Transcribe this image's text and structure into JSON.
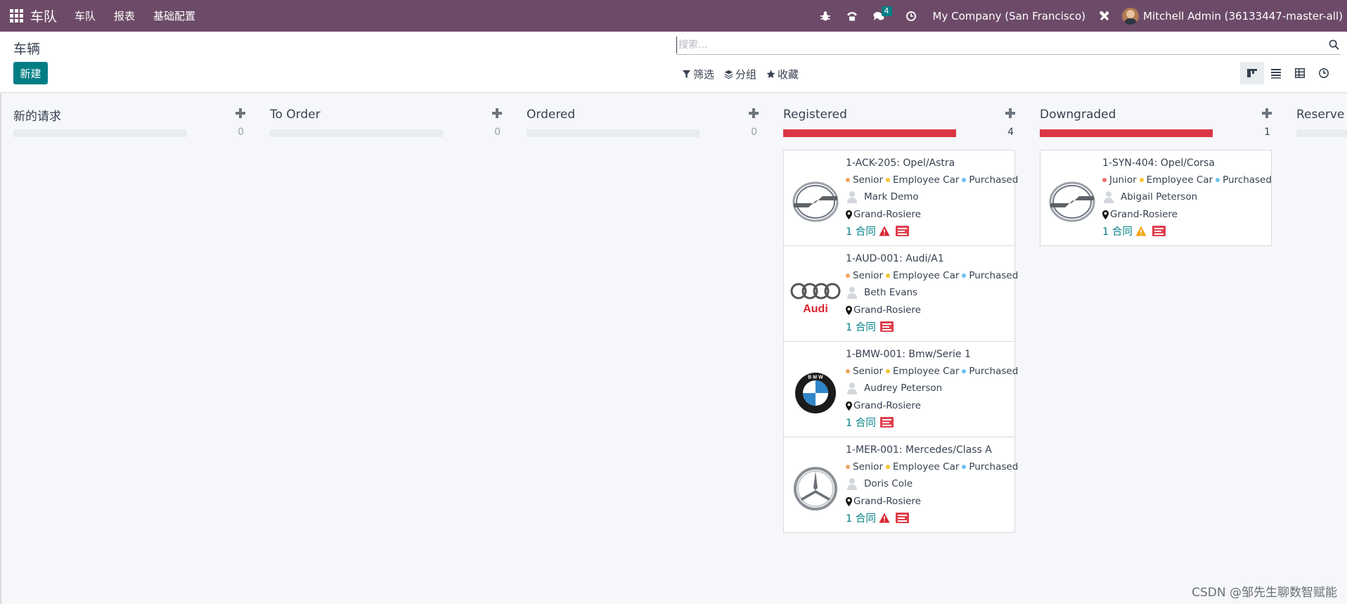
{
  "navbar": {
    "brand": "车队",
    "menu": [
      "车队",
      "报表",
      "基础配置"
    ],
    "messages_badge": "4",
    "company": "My Company (San Francisco)",
    "user": "Mitchell Admin (36133447-master-all)"
  },
  "control_panel": {
    "title": "车辆",
    "new_button": "新建",
    "search_placeholder": "搜索...",
    "filters": [
      "筛选",
      "分组",
      "收藏"
    ]
  },
  "columns": [
    {
      "title": "新的请求",
      "count": "0",
      "progress": 0,
      "cards": []
    },
    {
      "title": "To Order",
      "count": "0",
      "progress": 0,
      "cards": []
    },
    {
      "title": "Ordered",
      "count": "0",
      "progress": 0,
      "cards": []
    },
    {
      "title": "Registered",
      "count": "4",
      "progress": 1,
      "cards": [
        {
          "title": "1-ACK-205: Opel/Astra",
          "tags": [
            "Senior",
            "Employee Car",
            "Purchased"
          ],
          "driver": "Mark Demo",
          "location": "Grand-Rosiere",
          "contracts": "1 合同",
          "logo": "opel-logo",
          "warning": "red"
        },
        {
          "title": "1-AUD-001: Audi/A1",
          "tags": [
            "Senior",
            "Employee Car",
            "Purchased"
          ],
          "driver": "Beth Evans",
          "location": "Grand-Rosiere",
          "contracts": "1 合同",
          "logo": "audi-logo",
          "logo_text": "Audi",
          "warning": "none"
        },
        {
          "title": "1-BMW-001: Bmw/Serie 1",
          "tags": [
            "Senior",
            "Employee Car",
            "Purchased"
          ],
          "driver": "Audrey Peterson",
          "location": "Grand-Rosiere",
          "contracts": "1 合同",
          "logo": "bmw-logo",
          "logo_text": "B M W",
          "warning": "none"
        },
        {
          "title": "1-MER-001: Mercedes/Class A",
          "tags": [
            "Senior",
            "Employee Car",
            "Purchased"
          ],
          "driver": "Doris Cole",
          "location": "Grand-Rosiere",
          "contracts": "1 合同",
          "logo": "mercedes-logo",
          "warning": "red"
        }
      ]
    },
    {
      "title": "Downgraded",
      "count": "1",
      "progress": 1,
      "cards": [
        {
          "title": "1-SYN-404: Opel/Corsa",
          "tags": [
            "Junior",
            "Employee Car",
            "Purchased"
          ],
          "driver": "Abigail Peterson",
          "location": "Grand-Rosiere",
          "contracts": "1 合同",
          "logo": "opel-logo",
          "warning": "orange"
        }
      ]
    },
    {
      "title": "Reserve",
      "count": "",
      "progress": 0,
      "cards": []
    }
  ],
  "colors": {
    "navbar": "#6d4b68",
    "primary": "#017e84",
    "progress_danger": "#dc3545",
    "tag_senior": "#f0a35e",
    "tag_junior": "#e86a6a",
    "tag_employee_car": "#f4c430",
    "tag_purchased": "#6cc1ed",
    "warn_red": "#d9232e",
    "warn_orange": "#f3a20a"
  },
  "watermark": "CSDN @邹先生聊数智赋能"
}
